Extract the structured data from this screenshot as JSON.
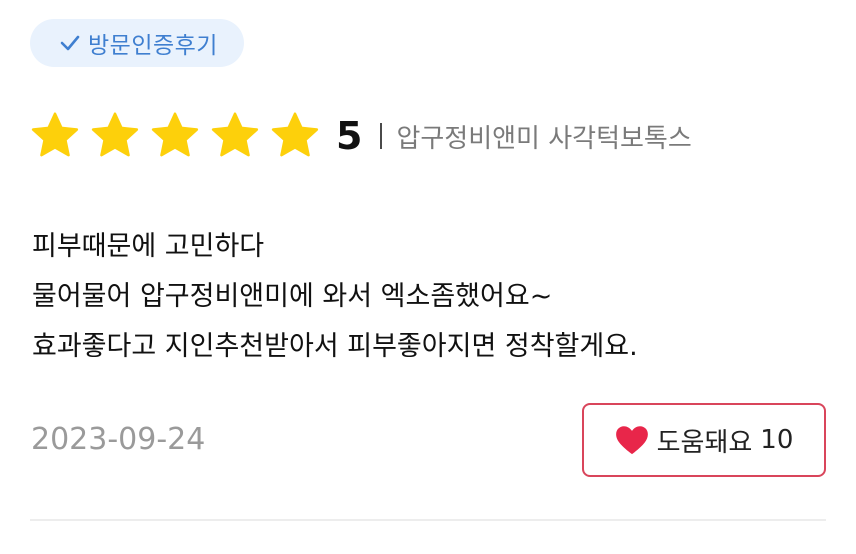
{
  "badge": {
    "label": "방문인증후기",
    "icon": "checkmark-icon",
    "color": "#3f7fd0",
    "background": "#e9f2fd"
  },
  "rating": {
    "stars": 5,
    "max_stars": 5,
    "score": "5",
    "star_color": "#fdd00b",
    "treatment": "압구정비앤미 사각턱보톡스"
  },
  "review": {
    "lines": [
      "피부때문에 고민하다",
      "물어물어 압구정비앤미에 와서 엑소좀했어요~",
      "효과좋다고 지인추천받아서 피부좋아지면 정착할게요."
    ]
  },
  "meta": {
    "date": "2023-09-24"
  },
  "helpful": {
    "label": "도움돼요",
    "count": "10",
    "icon": "heart-icon",
    "accent": "#e8264a"
  }
}
